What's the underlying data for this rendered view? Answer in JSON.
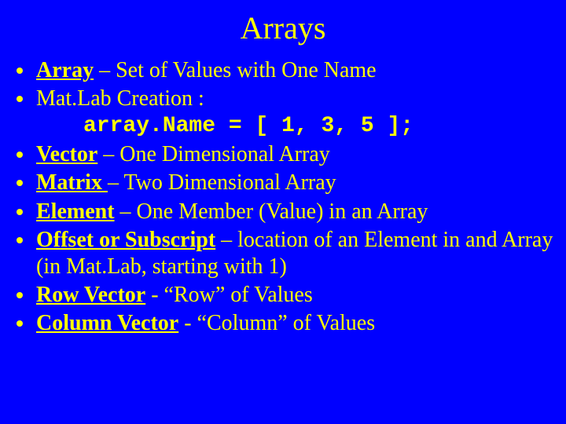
{
  "title": "Arrays",
  "items": [
    {
      "term": "Array",
      "rest": " – Set of Values with One Name"
    },
    {
      "plain": "Mat.Lab Creation :",
      "code": "array.Name = [ 1, 3, 5 ];"
    },
    {
      "term": "Vector",
      "rest": " – One Dimensional Array"
    },
    {
      "term": "Matrix ",
      "rest": "– Two Dimensional Array"
    },
    {
      "term": "Element",
      "rest": " – One Member (Value) in an Array"
    },
    {
      "term": "Offset or Subscript",
      "rest": " – location of an Element in and Array (in Mat.Lab, starting with 1)"
    },
    {
      "term": "Row Vector",
      "rest": " - “Row” of Values"
    },
    {
      "term": "Column Vector",
      "rest": " - “Column” of Values"
    }
  ]
}
